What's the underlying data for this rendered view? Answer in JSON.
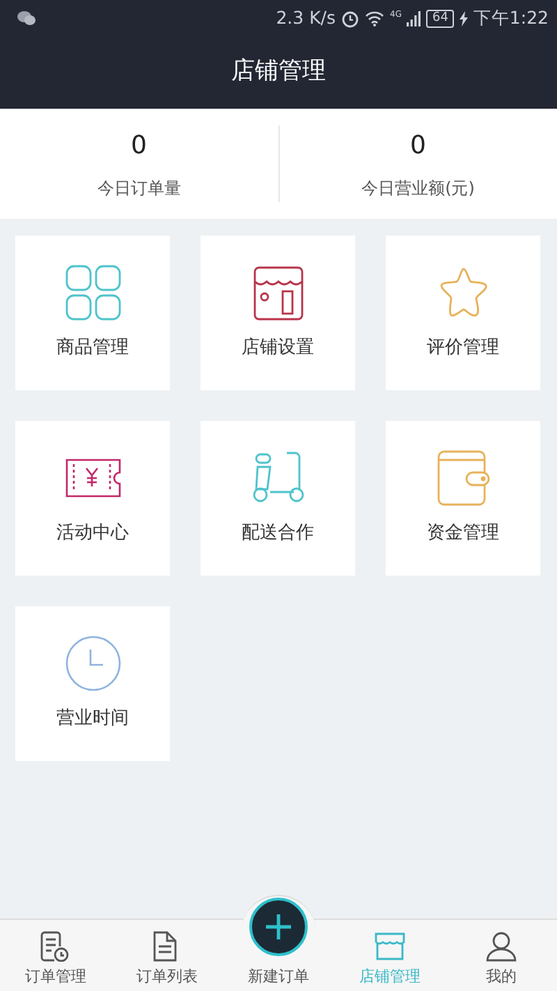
{
  "status_bar": {
    "speed": "2.3 K/s",
    "network": "4G",
    "battery": "64",
    "time": "下午1:22"
  },
  "header": {
    "title": "店铺管理"
  },
  "stats": [
    {
      "value": "0",
      "label": "今日订单量"
    },
    {
      "value": "0",
      "label": "今日营业额(元)"
    }
  ],
  "tiles": [
    {
      "kind": "goods",
      "label": "商品管理"
    },
    {
      "kind": "shop",
      "label": "店铺设置"
    },
    {
      "kind": "review",
      "label": "评价管理"
    },
    {
      "kind": "coupon",
      "label": "活动中心"
    },
    {
      "kind": "delivery",
      "label": "配送合作"
    },
    {
      "kind": "wallet",
      "label": "资金管理"
    },
    {
      "kind": "clock",
      "label": "营业时间"
    }
  ],
  "tab_bar": [
    {
      "kind": "orders",
      "label": "订单管理",
      "selected": false
    },
    {
      "kind": "list",
      "label": "订单列表",
      "selected": false
    },
    {
      "kind": "add",
      "label": "新建订单",
      "selected": false
    },
    {
      "kind": "shop",
      "label": "店铺管理",
      "selected": true
    },
    {
      "kind": "me",
      "label": "我的",
      "selected": false
    }
  ]
}
